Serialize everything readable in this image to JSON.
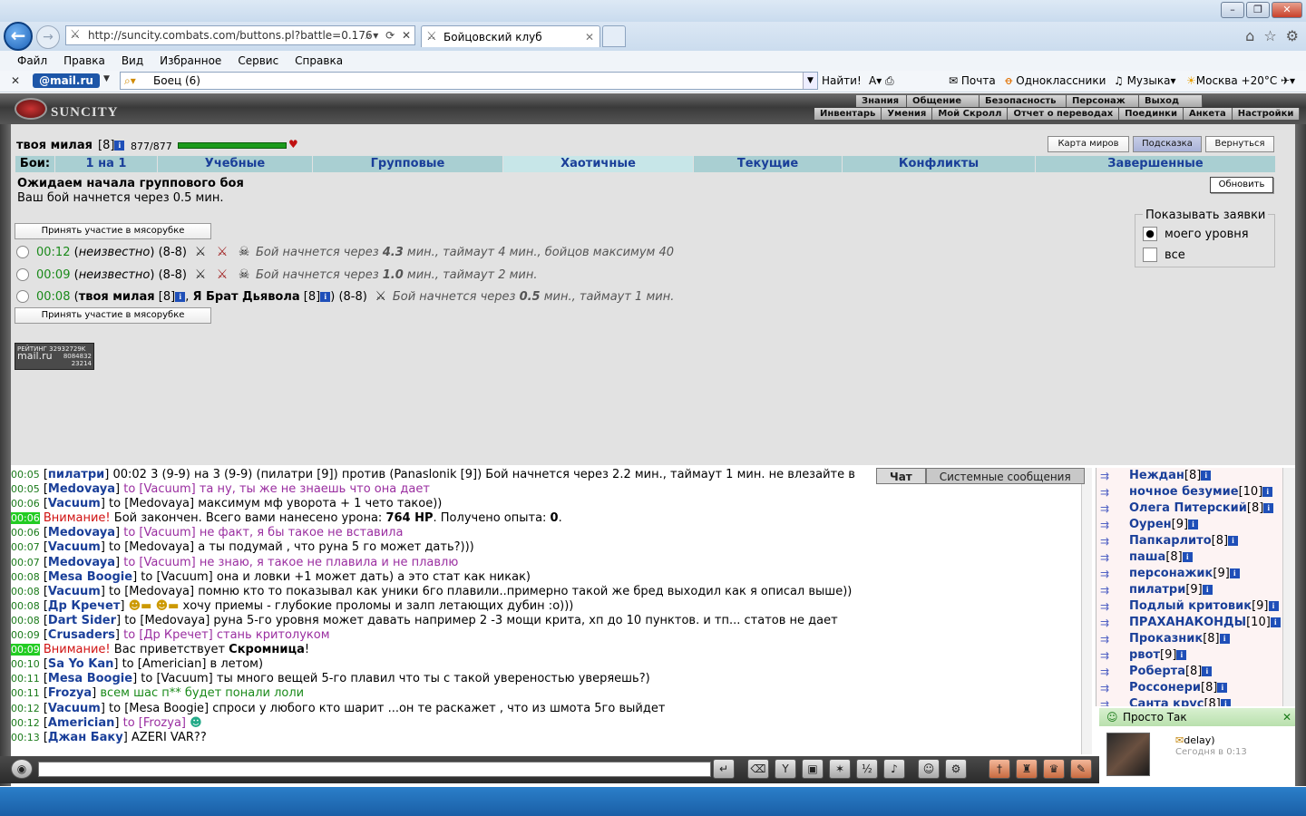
{
  "browser": {
    "address": "http://suncity.combats.com/buttons.pl?battle=0.176",
    "tab_title": "Бойцовский клуб",
    "menus": [
      "Файл",
      "Правка",
      "Вид",
      "Избранное",
      "Сервис",
      "Справка"
    ],
    "mail_logo": "@mail.ru",
    "search_value": "Боец (6)",
    "find_label": "Найти!",
    "toolbar": {
      "mail": "Почта",
      "ok": "Одноклассники",
      "music": "Музыка",
      "weather": "Москва +20°C"
    }
  },
  "game_menu": {
    "top": [
      "Знания",
      "Общение",
      "Безопасность",
      "Персонаж",
      "Выход"
    ],
    "bottom": [
      "Инвентарь",
      "Умения",
      "Мой Скролл",
      "Отчет о переводах",
      "Поединки",
      "Анкета",
      "Настройки"
    ]
  },
  "logo_text": "SUNCITY",
  "player": {
    "name": "твоя милая",
    "level": "[8]",
    "hp": "877/877",
    "hp_fraction": 1.0
  },
  "top_buttons": {
    "map": "Карта миров",
    "hint": "Подсказка",
    "back": "Вернуться"
  },
  "battle_tabs": {
    "label": "Бои:",
    "items": [
      "1 на 1",
      "Учебные",
      "Групповые",
      "Хаотичные",
      "Текущие",
      "Конфликты",
      "Завершенные"
    ],
    "selected": "Хаотичные"
  },
  "status": {
    "heading": "Ожидаем начала группового боя",
    "sub": "Ваш бой начнется через 0.5 мин.",
    "refresh": "Обновить"
  },
  "join_label": "Принять участие в мясорубке",
  "battles": [
    {
      "time": "00:12",
      "who": "неизвестно",
      "range": "(8-8)",
      "pre": "Бой начнется через ",
      "mins": "4.3",
      "post": " мин., таймаут 4 мин., бойцов максимум 40"
    },
    {
      "time": "00:09",
      "who": "неизвестно",
      "range": "(8-8)",
      "pre": "Бой начнется через ",
      "mins": "1.0",
      "post": " мин., таймаут 2 мин."
    },
    {
      "time": "00:08",
      "p1": "твоя милая",
      "p1lvl": "[8]",
      "p2": "Я Брат Дьявола",
      "p2lvl": "[8]",
      "range": "(8-8)",
      "pre": "Бой начнется через ",
      "mins": "0.5",
      "post": " мин., таймаут 1 мин."
    }
  ],
  "filter": {
    "legend": "Показывать заявки",
    "opt1": "моего уровня",
    "opt2": "все"
  },
  "rating": {
    "label": "РЕЙТИНГ",
    "num1": "32932729K",
    "num2": "8084832",
    "num3": "23214",
    "brand": "mail.ru"
  },
  "chat_tabs": [
    "Чат",
    "Системные сообщения"
  ],
  "chat": [
    {
      "t": "00:05",
      "n": "пилатри",
      "txt": " 00:02 3 (9-9) на 3 (9-9) (пилатри [9]) против (Panaslonik [9]) Бой начнется через 2.2 мин., таймаут 1 мин. не влезайте в"
    },
    {
      "t": "00:05",
      "n": "Medovaya",
      "to": "to [Vacuum] та ну, ты же не знаешь что она дает"
    },
    {
      "t": "00:06",
      "n": "Vacuum",
      "txt": " to [Medovaya] максимум мф уворота + 1 чето такое))"
    },
    {
      "sys": true,
      "t": "00:06",
      "warn": "Внимание!",
      "txt": " Бой закончен. Всего вами нанесено урона: ",
      "b1": "764 HP",
      "txt2": ". Получено опыта: ",
      "b2": "0",
      "txt3": "."
    },
    {
      "t": "00:06",
      "n": "Medovaya",
      "to": "to [Vacuum] не факт, я бы такое не вставила"
    },
    {
      "t": "00:07",
      "n": "Vacuum",
      "txt": " to [Medovaya] а ты подумай , что руна 5 го может дать?)))"
    },
    {
      "t": "00:07",
      "n": "Medovaya",
      "to": "to [Vacuum] не знаю, я такое не плавила и не плавлю"
    },
    {
      "t": "00:08",
      "n": "Mesa Boogie",
      "txt": " to [Vacuum] она и ловки +1 может дать) а это стат как никак)"
    },
    {
      "t": "00:08",
      "n": "Vacuum",
      "txt": " to [Medovaya] помню кто то показывал как уники 6го плавили..примерно такой же бред выходил как я описал выше))"
    },
    {
      "t": "00:08",
      "n": "Др Кречет",
      "txt": " хочу приемы - глубокие проломы и залп летающих дубин :о)))",
      "emo": true
    },
    {
      "t": "00:08",
      "n": "Dart Sider",
      "txt": " to [Medovaya] руна 5-го уровня может давать например 2 -3 мощи крита, хп до 10 пунктов. и тп... статов не дает"
    },
    {
      "t": "00:09",
      "n": "Crusaders",
      "to": "to [Др Кречет] стань критолуком"
    },
    {
      "sys": true,
      "t": "00:09",
      "warn": "Внимание!",
      "txt": " Вас приветствует ",
      "b1": "Скромница",
      "txt2": "!"
    },
    {
      "t": "00:10",
      "n": "Sa Yo Kan",
      "txt": " to [Americian] в летом)"
    },
    {
      "t": "00:11",
      "n": "Mesa Boogie",
      "txt": " to [Vacuum] ты много вещей 5-го плавил что ты с такой увереностью уверяешь?)"
    },
    {
      "t": "00:11",
      "n": "Frozya",
      "green": " всем шас п** будет понали лоли"
    },
    {
      "t": "00:12",
      "n": "Vacuum",
      "txt": " to [Mesa Boogie] спроси у любого кто шарит ...он те раскажет , что из шмота 5го выйдет"
    },
    {
      "t": "00:12",
      "n": "Americian",
      "to": "to [Frozya]",
      "smile": true
    },
    {
      "t": "00:13",
      "n": "Джан Баку",
      "txt": " AZERI VAR??"
    }
  ],
  "users": [
    {
      "name": "Неждан",
      "lvl": "[8]"
    },
    {
      "name": "ночное безумие",
      "lvl": "[10]"
    },
    {
      "name": "Олега Питерский",
      "lvl": "[8]"
    },
    {
      "name": "Оурен",
      "lvl": "[9]"
    },
    {
      "name": "Папкарлито",
      "lvl": "[8]"
    },
    {
      "name": "паша",
      "lvl": "[8]"
    },
    {
      "name": "персонажик",
      "lvl": "[9]"
    },
    {
      "name": "пилатри",
      "lvl": "[9]"
    },
    {
      "name": "Подлый критовик",
      "lvl": "[9]"
    },
    {
      "name": "ПРАХАНАКОНДЫ",
      "lvl": "[10]"
    },
    {
      "name": "Проказник",
      "lvl": "[8]"
    },
    {
      "name": "рвот",
      "lvl": "[9]"
    },
    {
      "name": "Роберта",
      "lvl": "[8]"
    },
    {
      "name": "Россонери",
      "lvl": "[8]"
    },
    {
      "name": "Санта крус",
      "lvl": "[8]"
    }
  ],
  "notify": {
    "title": "Просто Так",
    "name": "delay)",
    "time": "Сегодня в 0:13"
  }
}
